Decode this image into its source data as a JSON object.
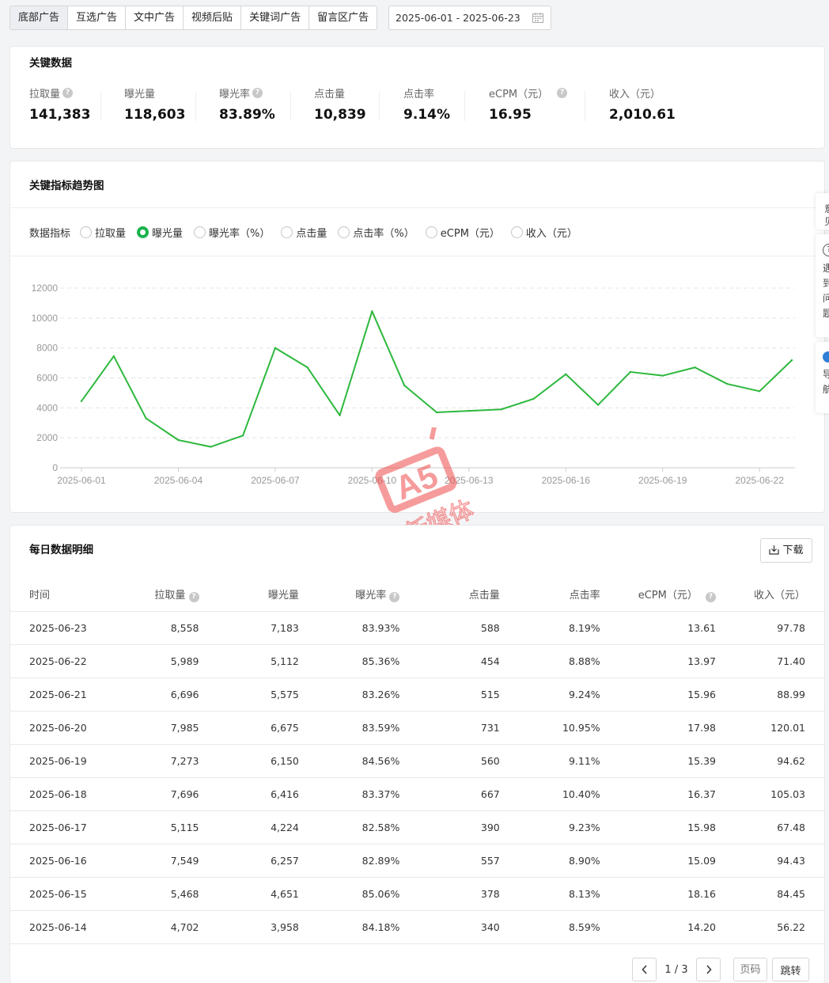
{
  "tabs": [
    "底部广告",
    "互选广告",
    "文中广告",
    "视频后贴",
    "关键词广告",
    "留言区广告"
  ],
  "date_range": "2025-06-01 - 2025-06-23",
  "key_data": {
    "title": "关键数据",
    "metrics": [
      {
        "label": "拉取量",
        "value": "141,383",
        "help": true
      },
      {
        "label": "曝光量",
        "value": "118,603",
        "help": false
      },
      {
        "label": "曝光率",
        "value": "83.89%",
        "help": true
      },
      {
        "label": "点击量",
        "value": "10,839",
        "help": false
      },
      {
        "label": "点击率",
        "value": "9.14%",
        "help": false
      },
      {
        "label": "eCPM（元）",
        "value": "16.95",
        "help": true
      },
      {
        "label": "收入（元）",
        "value": "2,010.61",
        "help": false
      }
    ]
  },
  "trend": {
    "title": "关键指标趋势图",
    "indicator_label": "数据指标",
    "options": [
      "拉取量",
      "曝光量",
      "曝光率（%）",
      "点击量",
      "点击率（%）",
      "eCPM（元）",
      "收入（元）"
    ],
    "selected_index": 1
  },
  "chart_data": {
    "type": "line",
    "series": [
      {
        "values": [
          4450,
          7450,
          3300,
          1850,
          1400,
          2150,
          8000,
          6700,
          3500,
          10450,
          5500,
          3700,
          3800,
          3900,
          4600,
          6250,
          4200,
          6400,
          6150,
          6700,
          5600,
          5112,
          7183
        ]
      }
    ],
    "x": [
      "2025-06-01",
      "2025-06-02",
      "2025-06-03",
      "2025-06-04",
      "2025-06-05",
      "2025-06-06",
      "2025-06-07",
      "2025-06-08",
      "2025-06-09",
      "2025-06-10",
      "2025-06-11",
      "2025-06-12",
      "2025-06-13",
      "2025-06-14",
      "2025-06-15",
      "2025-06-16",
      "2025-06-17",
      "2025-06-18",
      "2025-06-19",
      "2025-06-20",
      "2025-06-21",
      "2025-06-22",
      "2025-06-23"
    ],
    "x_tick_labels": [
      "2025-06-01",
      "2025-06-04",
      "2025-06-07",
      "2025-06-10",
      "2025-06-13",
      "2025-06-16",
      "2025-06-19",
      "2025-06-22"
    ],
    "y_ticks": [
      0,
      2000,
      4000,
      6000,
      8000,
      10000,
      12000
    ],
    "ylim": [
      0,
      12000
    ],
    "grid": true,
    "color": "#2db83d"
  },
  "daily": {
    "title": "每日数据明细",
    "download_label": "下载",
    "columns": [
      "时间",
      "拉取量",
      "曝光量",
      "曝光率",
      "点击量",
      "点击率",
      "eCPM（元）",
      "收入（元）"
    ],
    "rows": [
      [
        "2025-06-23",
        "8,558",
        "7,183",
        "83.93%",
        "588",
        "8.19%",
        "13.61",
        "97.78"
      ],
      [
        "2025-06-22",
        "5,989",
        "5,112",
        "85.36%",
        "454",
        "8.88%",
        "13.97",
        "71.40"
      ],
      [
        "2025-06-21",
        "6,696",
        "5,575",
        "83.26%",
        "515",
        "9.24%",
        "15.96",
        "88.99"
      ],
      [
        "2025-06-20",
        "7,985",
        "6,675",
        "83.59%",
        "731",
        "10.95%",
        "17.98",
        "120.01"
      ],
      [
        "2025-06-19",
        "7,273",
        "6,150",
        "84.56%",
        "560",
        "9.11%",
        "15.39",
        "94.62"
      ],
      [
        "2025-06-18",
        "7,696",
        "6,416",
        "83.37%",
        "667",
        "10.40%",
        "16.37",
        "105.03"
      ],
      [
        "2025-06-17",
        "5,115",
        "4,224",
        "82.58%",
        "390",
        "9.23%",
        "15.98",
        "67.48"
      ],
      [
        "2025-06-16",
        "7,549",
        "6,257",
        "82.89%",
        "557",
        "8.90%",
        "15.09",
        "94.43"
      ],
      [
        "2025-06-15",
        "5,468",
        "4,651",
        "85.06%",
        "378",
        "8.13%",
        "18.16",
        "84.45"
      ],
      [
        "2025-06-14",
        "4,702",
        "3,958",
        "84.18%",
        "340",
        "8.59%",
        "14.20",
        "56.22"
      ]
    ],
    "pagination": {
      "page_text": "1 / 3",
      "page_input_placeholder": "页码",
      "jump_label": "跳转"
    }
  },
  "side_panel": {
    "text_top": "意见",
    "text_mid": "遇到问题",
    "text_bottom": "导航"
  },
  "colors": {
    "accent": "#1ab34d",
    "line": "#2db83d",
    "watermark": "#f04a4a"
  }
}
